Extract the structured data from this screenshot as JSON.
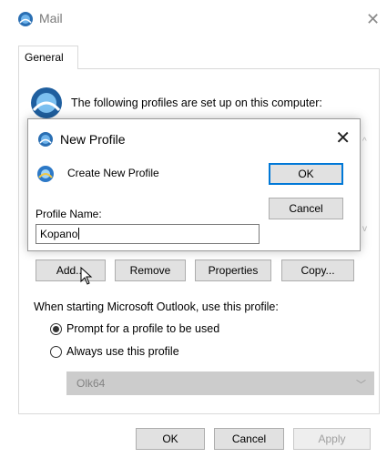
{
  "mail_window": {
    "title": "Mail",
    "tab_general": "General",
    "profiles_header": "The following profiles are set up on this computer:",
    "buttons": {
      "add": "Add...",
      "remove": "Remove",
      "properties": "Properties",
      "copy": "Copy..."
    },
    "startup_label": "When starting Microsoft Outlook, use this profile:",
    "radio_prompt": "Prompt for a profile to be used",
    "radio_always": "Always use this profile",
    "profile_select": "Olk64",
    "footer": {
      "ok": "OK",
      "cancel": "Cancel",
      "apply": "Apply"
    }
  },
  "new_profile_dialog": {
    "title": "New Profile",
    "create_label": "Create New Profile",
    "profile_name_label": "Profile Name:",
    "profile_name_value": "Kopano",
    "ok": "OK",
    "cancel": "Cancel"
  },
  "colors": {
    "accent": "#0078d7",
    "button_bg": "#e1e1e1"
  }
}
